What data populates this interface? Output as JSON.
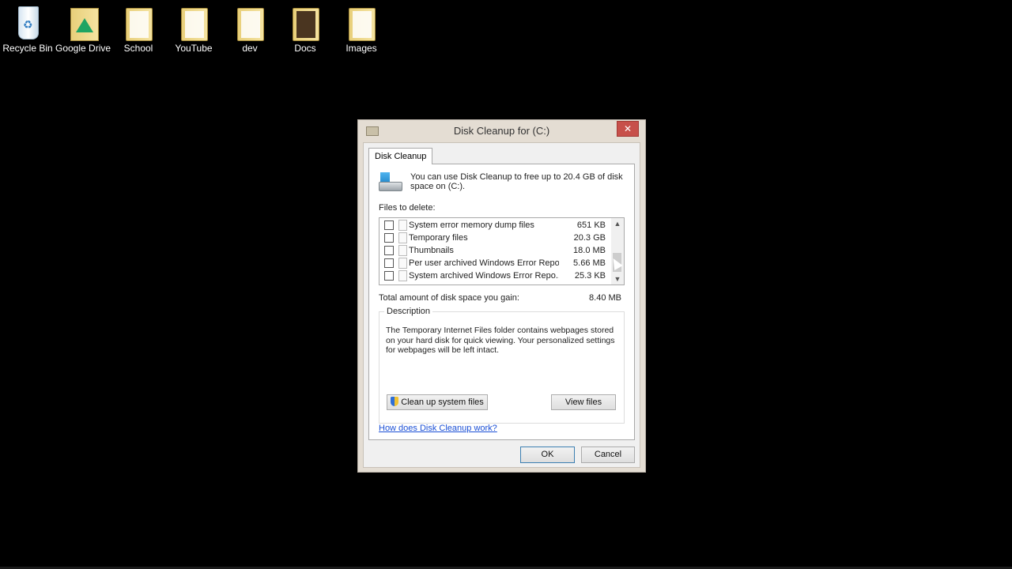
{
  "desktop": {
    "icons": [
      {
        "label": "Recycle Bin",
        "icon": "recycle-bin-icon"
      },
      {
        "label": "Google Drive",
        "icon": "google-drive-icon"
      },
      {
        "label": "School",
        "icon": "folder-icon"
      },
      {
        "label": "YouTube",
        "icon": "folder-icon"
      },
      {
        "label": "dev",
        "icon": "folder-icon"
      },
      {
        "label": "Docs",
        "icon": "folder-icon"
      },
      {
        "label": "Images",
        "icon": "folder-icon"
      }
    ]
  },
  "window": {
    "title": "Disk Cleanup for  (C:)",
    "close_glyph": "✕",
    "tab_label": "Disk Cleanup",
    "intro": "You can use Disk Cleanup to free up to 20.4 GB of disk space on  (C:).",
    "files_label": "Files to delete:",
    "files": [
      {
        "name": "System error memory dump files",
        "size": "651 KB",
        "checked": false
      },
      {
        "name": "Temporary files",
        "size": "20.3 GB",
        "checked": false
      },
      {
        "name": "Thumbnails",
        "size": "18.0 MB",
        "checked": false
      },
      {
        "name": "Per user archived Windows Error Repo...",
        "size": "5.66 MB",
        "checked": false
      },
      {
        "name": "System archived Windows Error Repo...",
        "size": "25.3 KB",
        "checked": false
      }
    ],
    "total_label": "Total amount of disk space you gain:",
    "total_value": "8.40 MB",
    "description_label": "Description",
    "description_text": "The Temporary Internet Files folder contains webpages stored on your hard disk for quick viewing. Your personalized settings for webpages will be left intact.",
    "cleanup_button": "Clean up system files",
    "view_button": "View files",
    "help_link": "How does Disk Cleanup work?",
    "ok_button": "OK",
    "cancel_button": "Cancel"
  },
  "colors": {
    "desktop_bg": "#000000",
    "close_button": "#c7504a",
    "link": "#1a4fd6"
  }
}
